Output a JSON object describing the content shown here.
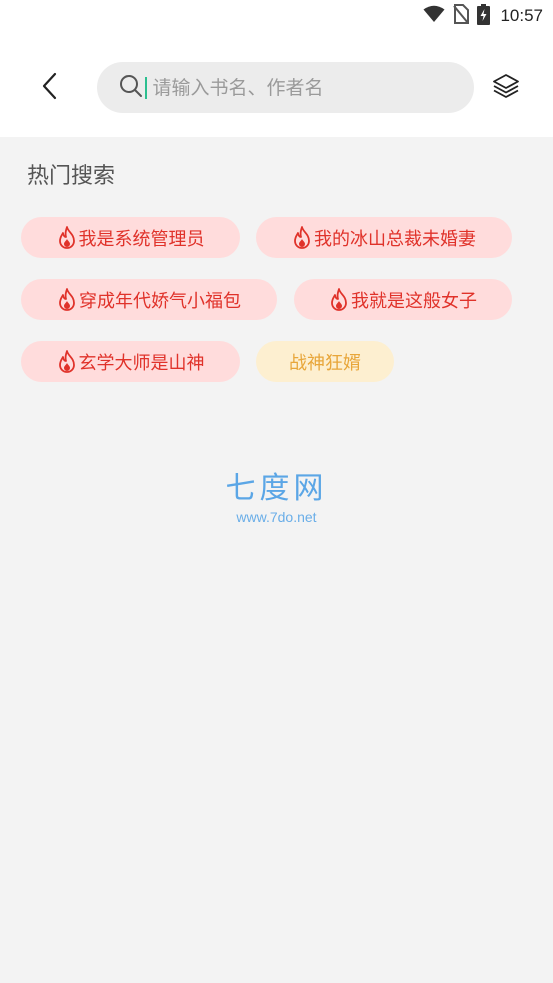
{
  "status_bar": {
    "time": "10:57",
    "icons": [
      "wifi-icon",
      "no-sim-icon",
      "battery-charging-icon"
    ]
  },
  "header": {
    "back_icon": "chevron-left-icon",
    "search": {
      "placeholder": "请输入书名、作者名",
      "value": ""
    },
    "layers_icon": "layers-icon"
  },
  "hot_search": {
    "title": "热门搜索",
    "items": [
      {
        "label": "我是系统管理员",
        "hot": true
      },
      {
        "label": "我的冰山总裁未婚妻",
        "hot": true
      },
      {
        "label": "穿成年代娇气小福包",
        "hot": true
      },
      {
        "label": "我就是这般女子",
        "hot": true
      },
      {
        "label": "玄学大师是山神",
        "hot": true
      },
      {
        "label": "战神狂婿",
        "hot": false
      }
    ]
  },
  "watermark": {
    "title": "七度网",
    "url": "www.7do.net"
  },
  "colors": {
    "tag_hot_bg": "#ffdcdc",
    "tag_hot_text": "#e0322a",
    "tag_plain_bg": "#fdefd0",
    "tag_plain_text": "#e8a63a",
    "page_bg": "#f3f3f3"
  }
}
